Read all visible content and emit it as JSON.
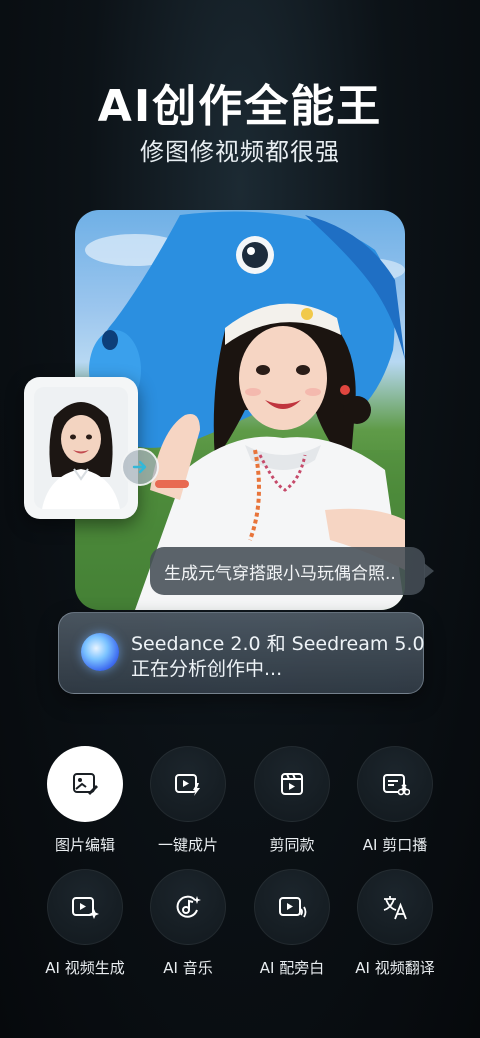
{
  "hero": {
    "title": "AI创作全能王",
    "subtitle": "修图修视频都很强"
  },
  "prompt": {
    "text": "生成元气穿搭跟小马玩偶合照.."
  },
  "status": {
    "line1": "Seedance 2.0 和 Seedream 5.0",
    "line2": "正在分析创作中..."
  },
  "tools": [
    {
      "label": "图片编辑",
      "icon": "image-edit-icon"
    },
    {
      "label": "一键成片",
      "icon": "video-flash-icon"
    },
    {
      "label": "剪同款",
      "icon": "clapperboard-icon"
    },
    {
      "label": "AI 剪口播",
      "icon": "ai-cut-icon"
    },
    {
      "label": "AI 视频生成",
      "icon": "video-sparkle-icon"
    },
    {
      "label": "AI 音乐",
      "icon": "music-icon"
    },
    {
      "label": "AI 配旁白",
      "icon": "voiceover-icon"
    },
    {
      "label": "AI 视频翻译",
      "icon": "translate-icon"
    }
  ],
  "colors": {
    "background": "#0c1217",
    "active_tool": "#ffffff",
    "accent_arrow": "#33b8d8"
  }
}
